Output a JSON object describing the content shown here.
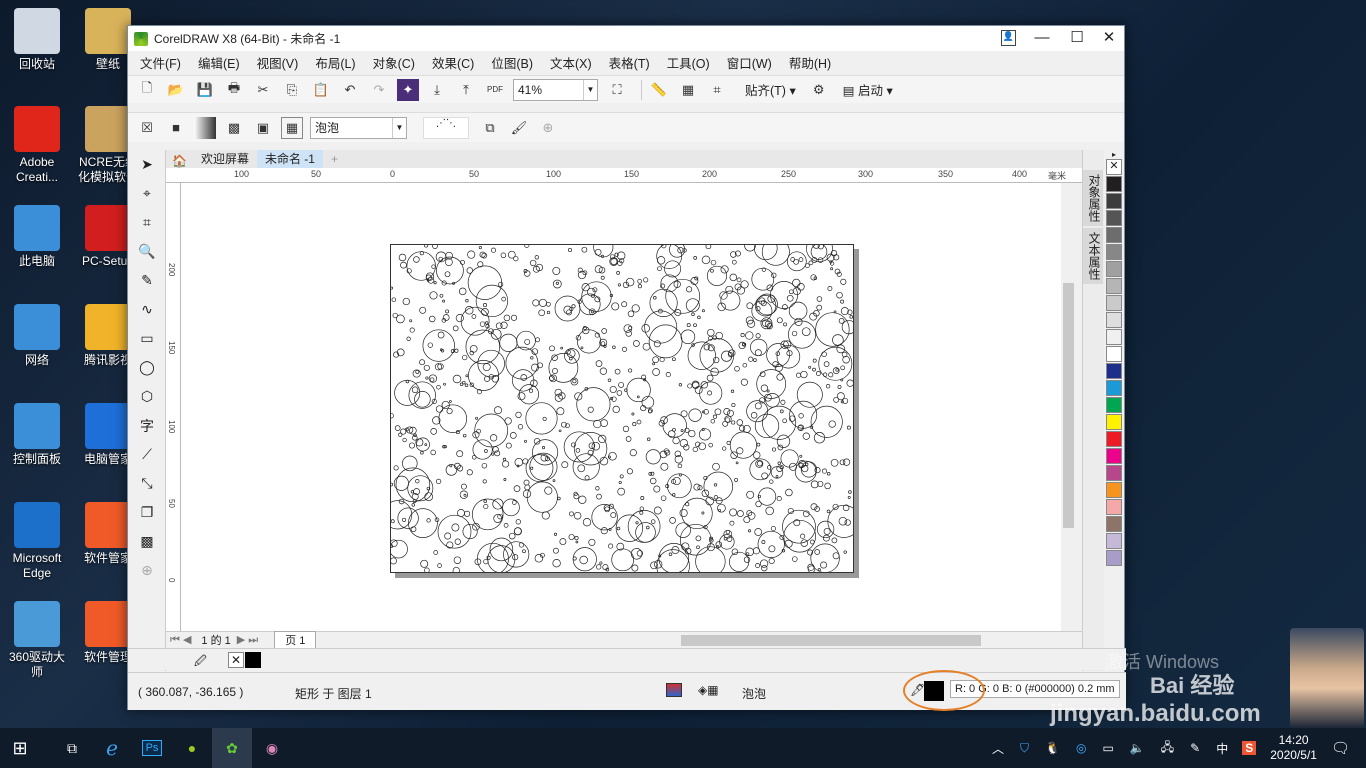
{
  "desktop_icons": [
    {
      "label": "回收站",
      "color": "#cfd8e3"
    },
    {
      "label": "壁纸",
      "color": "#d9b35a"
    },
    {
      "label": "Adobe Creati...",
      "color": "#e0261b"
    },
    {
      "label": "NCRE无纸化模拟软件",
      "color": "#caa35f"
    },
    {
      "label": "此电脑",
      "color": "#3a8fd8"
    },
    {
      "label": "PC-Setup",
      "color": "#d21e1e"
    },
    {
      "label": "网络",
      "color": "#3a8fd8"
    },
    {
      "label": "腾讯影视",
      "color": "#f0b32a"
    },
    {
      "label": "控制面板",
      "color": "#3a8fd8"
    },
    {
      "label": "电脑管家",
      "color": "#1e6fd8"
    },
    {
      "label": "Microsoft Edge",
      "color": "#1c70c9"
    },
    {
      "label": "软件管家",
      "color": "#f05a28"
    },
    {
      "label": "360驱动大师",
      "color": "#4a9ad8"
    },
    {
      "label": "软件管理",
      "color": "#f05a28"
    }
  ],
  "window": {
    "title": "CorelDRAW X8 (64-Bit) - 未命名 -1",
    "controls": {
      "minimize": "—",
      "maximize": "☐",
      "close": "✕"
    }
  },
  "menu": [
    "文件(F)",
    "编辑(E)",
    "视图(V)",
    "布局(L)",
    "对象(C)",
    "效果(C)",
    "位图(B)",
    "文本(X)",
    "表格(T)",
    "工具(O)",
    "窗口(W)",
    "帮助(H)"
  ],
  "toolbar": {
    "zoom": "41%",
    "snap_label": "贴齐(T)",
    "launch_label": "启动",
    "pdf_label": "PDF"
  },
  "propbar": {
    "fill_name": "泡泡"
  },
  "doc_tabs": [
    "欢迎屏幕",
    "未命名 -1"
  ],
  "ruler_h_labels": [
    "100",
    "50",
    "0",
    "50",
    "100",
    "150",
    "200",
    "250",
    "300",
    "350",
    "400",
    "毫米"
  ],
  "ruler_v_labels": [
    "200",
    "150",
    "100",
    "50",
    "0"
  ],
  "page_nav": {
    "text": "1 的 1",
    "page_tab": "页 1"
  },
  "dockers": [
    "对象属性",
    "文本属性"
  ],
  "palette": [
    "#ffffff",
    "#231f20",
    "#3d3d3d",
    "#555555",
    "#6d6d6d",
    "#878787",
    "#a0a0a0",
    "#b5b5b5",
    "#cacaca",
    "#dedede",
    "#f0f0f0",
    "#ffffff",
    "#1d2f8a",
    "#1a9ad7",
    "#00a650",
    "#fff200",
    "#ed1c24",
    "#ec008c",
    "#b8468b",
    "#f7941d",
    "#f4a8a8",
    "#8c7469",
    "#c6b8d8",
    "#a89cc8"
  ],
  "status": {
    "coords": "( 360.087, -36.165 )",
    "object": "矩形 于 图层 1",
    "fill_name": "泡泡",
    "outline": "R: 0 G: 0 B: 0 (#000000) 0.2 mm"
  },
  "taskbar": {
    "time": "14:20",
    "date": "2020/5/1",
    "ime": "中"
  },
  "watermark": {
    "activate": "激活 Windows",
    "site": "jingyan.baidu.com",
    "brand": "Bai 经验"
  },
  "colors": {
    "accent": "#e58028",
    "window_border": "#7a8ba0"
  }
}
